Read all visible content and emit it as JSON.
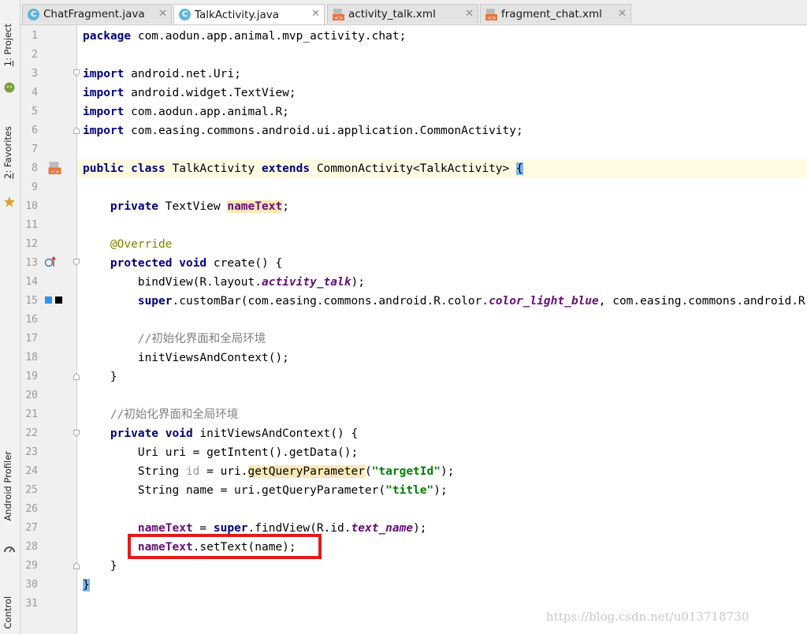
{
  "tool_window_stripe": {
    "project": {
      "number": "1",
      "label": ": Project"
    },
    "favorites": {
      "number": "2",
      "label": ": Favorites"
    },
    "android_profiler": "Android Profiler",
    "control": "Control"
  },
  "tabs": [
    {
      "label": "ChatFragment.java",
      "icon": "java-class-icon",
      "active": false
    },
    {
      "label": "TalkActivity.java",
      "icon": "java-class-icon",
      "active": true
    },
    {
      "label": "activity_talk.xml",
      "icon": "xml-layout-icon",
      "active": false
    },
    {
      "label": "fragment_chat.xml",
      "icon": "xml-layout-icon",
      "active": false
    }
  ],
  "editor": {
    "line_numbers": [
      "1",
      "2",
      "3",
      "4",
      "5",
      "6",
      "7",
      "8",
      "9",
      "10",
      "11",
      "12",
      "13",
      "14",
      "15",
      "16",
      "17",
      "18",
      "19",
      "20",
      "21",
      "22",
      "23",
      "24",
      "25",
      "26",
      "27",
      "28",
      "29",
      "30",
      "31"
    ],
    "code": {
      "l1_kw": "package",
      "l1_rest": " com.aodun.app.animal.mvp_activity.chat;",
      "import_kw": "import",
      "l3_rest": " android.net.Uri;",
      "l4_rest": " android.widget.TextView;",
      "l5_rest": " com.aodun.app.animal.R;",
      "l6_rest": " com.easing.commons.android.ui.application.CommonActivity;",
      "l8_kw1": "public class",
      "l8_name": " TalkActivity ",
      "l8_kw2": "extends",
      "l8_rest": " CommonActivity<TalkActivity> ",
      "l8_brace": "{",
      "l10_kw": "private",
      "l10_type": " TextView ",
      "l10_field": "nameText",
      "l10_end": ";",
      "l12_ann": "@Override",
      "l13_kw1": "protected",
      "l13_sp": " ",
      "l13_kw2": "void",
      "l13_rest": " create() {",
      "l14_pre": "bindView(R.layout.",
      "l14_sfield": "activity_talk",
      "l14_end": ");",
      "l15_kw": "super",
      "l15_mid": ".customBar(com.easing.commons.android.R.color.",
      "l15_sfield": "color_light_blue",
      "l15_end": ", com.easing.commons.android.R.color.",
      "l17_cmt": "//初始化界面和全局环境",
      "l18_code": "initViewsAndContext();",
      "l19_code": "}",
      "l21_cmt": "//初始化界面和全局环境",
      "l22_kw1": "private",
      "l22_sp": " ",
      "l22_kw2": "void",
      "l22_rest": " initViewsAndContext() {",
      "l23_code": "Uri uri = getIntent().getData();",
      "l24_pre": "String ",
      "l24_var": "id",
      "l24_mid": " = uri.",
      "l24_method": "getQueryParameter",
      "l24_open": "(",
      "l24_str": "\"targetId\"",
      "l24_end": ");",
      "l25_pre": "String name = uri.getQueryParameter(",
      "l25_str": "\"title\"",
      "l25_end": ");",
      "l27_field": "nameText",
      "l27_mid": " = ",
      "l27_kw": "super",
      "l27_rest": ".findView(R.id.",
      "l27_sfield": "text_name",
      "l27_end": ");",
      "l28_field": "nameText",
      "l28_rest": ".setText(name);",
      "l29_code": "}",
      "l30_brace": "}"
    }
  },
  "watermark": "https://blog.csdn.net/u013718730",
  "colors": {
    "keyword": "#000080",
    "annotation": "#808000",
    "comment": "#808080",
    "field": "#660e7a",
    "string": "#008000",
    "highlight_box": "#e21b1b",
    "current_line": "#fffbe3"
  }
}
